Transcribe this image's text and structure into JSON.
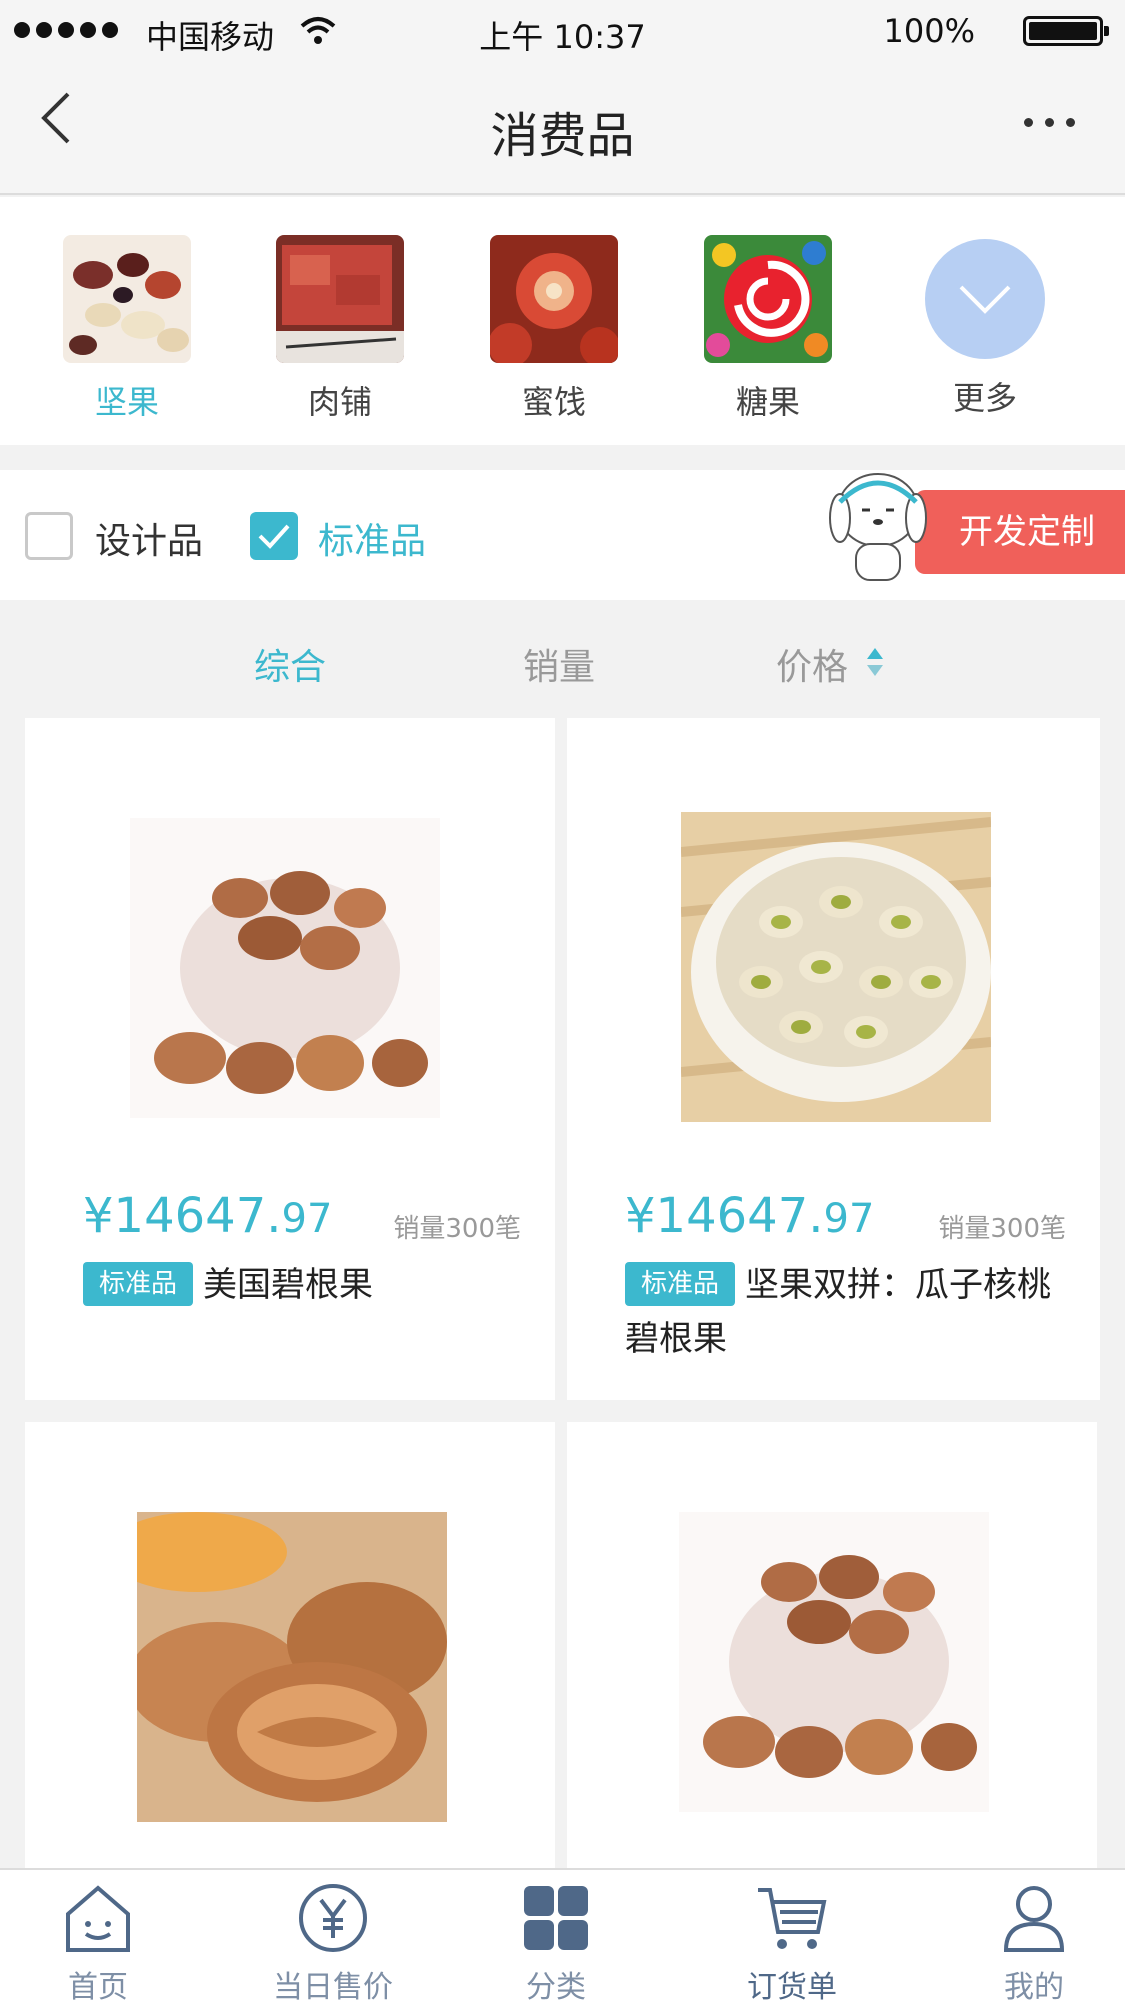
{
  "status_bar": {
    "carrier": "中国移动",
    "time": "上午 10:37",
    "battery": "100%"
  },
  "nav": {
    "title": "消费品",
    "back_icon": "chevron-left-icon",
    "more_icon": "more-dots-icon"
  },
  "categories": [
    {
      "label": "坚果",
      "active": true
    },
    {
      "label": "肉铺",
      "active": false
    },
    {
      "label": "蜜饯",
      "active": false
    },
    {
      "label": "糖果",
      "active": false
    },
    {
      "label": "更多",
      "active": false
    }
  ],
  "filter": {
    "design_label": "设计品",
    "design_checked": false,
    "standard_label": "标准品",
    "standard_checked": true,
    "custom_button": "开发定制"
  },
  "sort": {
    "overall": "综合",
    "sales": "销量",
    "price": "价格"
  },
  "products": [
    {
      "price_main": "¥14647.",
      "price_decimal": "97",
      "sales": "销量300笔",
      "badge": "标准品",
      "name": "美国碧根果"
    },
    {
      "price_main": "¥14647.",
      "price_decimal": "97",
      "sales": "销量300笔",
      "badge": "标准品",
      "name": "坚果双拼：瓜子核桃碧根果"
    },
    {},
    {}
  ],
  "tabs": [
    {
      "label": "首页",
      "icon": "home-icon"
    },
    {
      "label": "当日售价",
      "icon": "yen-icon"
    },
    {
      "label": "分类",
      "icon": "category-grid-icon"
    },
    {
      "label": "订货单",
      "icon": "cart-icon"
    },
    {
      "label": "我的",
      "icon": "user-icon"
    }
  ],
  "colors": {
    "accent": "#3cb8ce",
    "custom_button": "#f0605a",
    "more_circle": "#b7cff3",
    "tab_icon": "#4f6888"
  }
}
